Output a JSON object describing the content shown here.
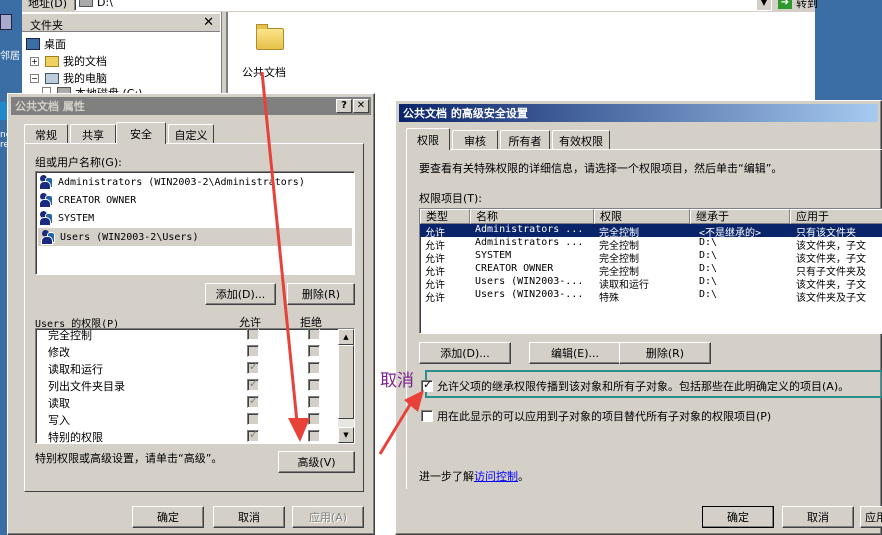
{
  "explorer": {
    "address_label": "地址(D)",
    "address_value": "D:\\",
    "go_label": "转到",
    "folders_title": "文件夹",
    "tree": [
      "桌面",
      "我的文档",
      "我的电脑",
      "本地磁盘 (C:)"
    ],
    "desktop_label_1": "邻居",
    "desktop_label_2": "ne re",
    "folder_item_label": "公共文档"
  },
  "props": {
    "title": "公共文档 属性",
    "tabs": [
      "常规",
      "共享",
      "安全",
      "自定义"
    ],
    "group_label": "组或用户名称(G):",
    "users": [
      "Administrators (WIN2003-2\\Administrators)",
      "CREATOR OWNER",
      "SYSTEM",
      "Users (WIN2003-2\\Users)"
    ],
    "add_button": "添加(D)...",
    "remove_button": "删除(R)",
    "perm_label": "Users 的权限(P)",
    "allow_header": "允许",
    "deny_header": "拒绝",
    "permissions": [
      {
        "name": "完全控制",
        "allow": false,
        "deny": false
      },
      {
        "name": "修改",
        "allow": false,
        "deny": false
      },
      {
        "name": "读取和运行",
        "allow": true,
        "deny": false
      },
      {
        "name": "列出文件夹目录",
        "allow": true,
        "deny": false
      },
      {
        "name": "读取",
        "allow": true,
        "deny": false
      },
      {
        "name": "写入",
        "allow": false,
        "deny": false
      },
      {
        "name": "特别的权限",
        "allow": true,
        "deny": false
      }
    ],
    "special_hint": "特别权限或高级设置，请单击“高级”。",
    "advanced_button": "高级(V)",
    "ok_button": "确定",
    "cancel_button": "取消",
    "apply_button": "应用(A)"
  },
  "adv": {
    "title": "公共文档 的高级安全设置",
    "tabs": [
      "权限",
      "审核",
      "所有者",
      "有效权限"
    ],
    "intro": "要查看有关特殊权限的详细信息，请选择一个权限项目，然后单击“编辑”。",
    "entries_label": "权限项目(T):",
    "columns": [
      "类型",
      "名称",
      "权限",
      "继承于",
      "应用于"
    ],
    "entries": [
      {
        "type": "允许",
        "name": "Administrators ...",
        "perm": "完全控制",
        "inherit": "<不是继承的>",
        "apply": "只有该文件夹"
      },
      {
        "type": "允许",
        "name": "Administrators ...",
        "perm": "完全控制",
        "inherit": "D:\\",
        "apply": "该文件夹，子文"
      },
      {
        "type": "允许",
        "name": "SYSTEM",
        "perm": "完全控制",
        "inherit": "D:\\",
        "apply": "该文件夹，子文"
      },
      {
        "type": "允许",
        "name": "CREATOR OWNER",
        "perm": "完全控制",
        "inherit": "D:\\",
        "apply": "只有子文件夹及"
      },
      {
        "type": "允许",
        "name": "Users (WIN2003-...",
        "perm": "读取和运行",
        "inherit": "D:\\",
        "apply": "该文件夹，子文"
      },
      {
        "type": "允许",
        "name": "Users (WIN2003-...",
        "perm": "特殊",
        "inherit": "D:\\",
        "apply": "该文件夹及子文"
      }
    ],
    "add_button": "添加(D)...",
    "edit_button": "编辑(E)...",
    "remove_button": "删除(R)",
    "inherit_option": "允许父项的继承权限传播到该对象和所有子对象。包括那些在此明确定义的项目(A)。",
    "inherit_checked": true,
    "replace_option": "用在此显示的可以应用到子对象的项目替代所有子对象的权限项目(P)",
    "replace_checked": false,
    "learn_prefix": "进一步了解",
    "learn_link": "访问控制",
    "learn_suffix": "。",
    "ok_button": "确定",
    "cancel_button": "取消",
    "apply_button": "应用"
  },
  "annotation": {
    "text": "取消",
    "text_color": "#7a1f8c",
    "arrow_color": "#e8413a",
    "box_color": "#2a8c8c"
  }
}
